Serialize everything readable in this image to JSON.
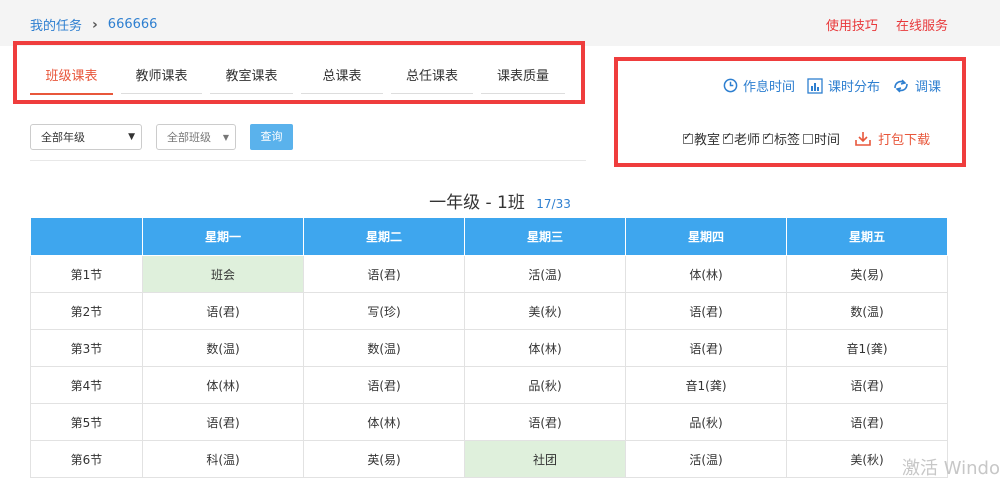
{
  "header": {
    "breadcrumb_root": "我的任务",
    "breadcrumb_current": "666666",
    "links": [
      "使用技巧",
      "在线服务"
    ]
  },
  "tabs": [
    "班级课表",
    "教师课表",
    "教室课表",
    "总课表",
    "总任课表",
    "课表质量"
  ],
  "active_tab": "班级课表",
  "filters": {
    "grade": "全部年级",
    "class": "全部班级",
    "query_label": "查询"
  },
  "ops": {
    "schedule_time": "作息时间",
    "hour_distribution": "课时分布",
    "adjust": "调课"
  },
  "checks": [
    {
      "label": "教室",
      "checked": true
    },
    {
      "label": "老师",
      "checked": true
    },
    {
      "label": "标签",
      "checked": true
    },
    {
      "label": "时间",
      "checked": false
    }
  ],
  "download_label": "打包下载",
  "timetable": {
    "title": "一年级 - 1班",
    "page": "17/33",
    "days": [
      "星期一",
      "星期二",
      "星期三",
      "星期四",
      "星期五"
    ],
    "rows": [
      {
        "period": "第1节",
        "cells": [
          "班会",
          "语(君)",
          "活(温)",
          "体(林)",
          "英(易)"
        ]
      },
      {
        "period": "第2节",
        "cells": [
          "语(君)",
          "写(珍)",
          "美(秋)",
          "语(君)",
          "数(温)"
        ]
      },
      {
        "period": "第3节",
        "cells": [
          "数(温)",
          "数(温)",
          "体(林)",
          "语(君)",
          "音1(龚)"
        ]
      },
      {
        "period": "第4节",
        "cells": [
          "体(林)",
          "语(君)",
          "品(秋)",
          "音1(龚)",
          "语(君)"
        ]
      },
      {
        "period": "第5节",
        "cells": [
          "语(君)",
          "体(林)",
          "语(君)",
          "品(秋)",
          "语(君)"
        ]
      },
      {
        "period": "第6节",
        "cells": [
          "科(温)",
          "英(易)",
          "社团",
          "活(温)",
          "美(秋)"
        ]
      }
    ],
    "highlighted": [
      "班会",
      "社团"
    ]
  },
  "colors": {
    "accent": "#3ea6ee",
    "link": "#2e7fd0",
    "alert": "#e8393b",
    "highlight_cell": "#dff0dc",
    "annotation": "#ef3d3d"
  },
  "watermark": "激活 Windo"
}
